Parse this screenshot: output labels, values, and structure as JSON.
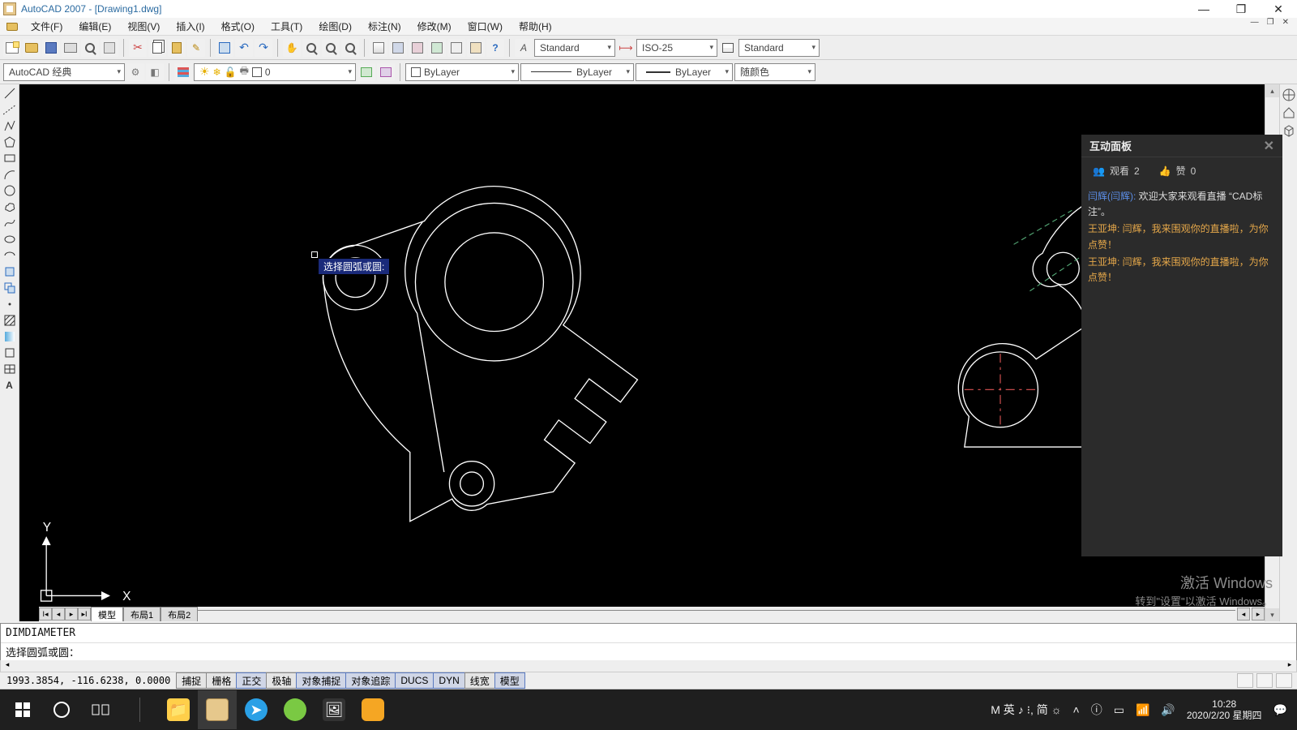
{
  "title": "AutoCAD 2007 - [Drawing1.dwg]",
  "menu": [
    "文件(F)",
    "编辑(E)",
    "视图(V)",
    "插入(I)",
    "格式(O)",
    "工具(T)",
    "绘图(D)",
    "标注(N)",
    "修改(M)",
    "窗口(W)",
    "帮助(H)"
  ],
  "styles": {
    "text_style": "Standard",
    "dim_style": "ISO-25",
    "table_style": "Standard"
  },
  "workspace_selector": "AutoCAD 经典",
  "layer_zero": "0",
  "layer_props": {
    "linetype": "ByLayer",
    "lineweight": "ByLayer",
    "color": "ByLayer",
    "plotcolor": "随颜色"
  },
  "tooltip": "选择圆弧或圆:",
  "chat": {
    "title": "互动面板",
    "views_label": "观看",
    "views": "2",
    "likes_label": "赞",
    "likes": "0",
    "messages": [
      {
        "author": "闫辉(闫辉):",
        "body": " 欢迎大家来观看直播 “CAD标注”。",
        "cls": "blue"
      },
      {
        "author": "王亚坤: ",
        "body": "闫辉，我来围观你的直播啦，为你点赞！",
        "cls": "gold"
      },
      {
        "author": "王亚坤: ",
        "body": "闫辉，我来围观你的直播啦，为你点赞！",
        "cls": "gold"
      }
    ]
  },
  "tabs": {
    "model": "模型",
    "layout1": "布局1",
    "layout2": "布局2"
  },
  "command": {
    "line1": "DIMDIAMETER",
    "line2": "选择圆弧或圆："
  },
  "status": {
    "coords": "1993.3854, -116.6238, 0.0000",
    "buttons": [
      "捕捉",
      "栅格",
      "正交",
      "极轴",
      "对象捕捉",
      "对象追踪",
      "DUCS",
      "DYN",
      "线宽",
      "模型"
    ]
  },
  "ucs": {
    "x": "X",
    "y": "Y"
  },
  "watermark": {
    "l1": "激活 Windows",
    "l2": "转到\"设置\"以激活 Windows。"
  },
  "taskbar": {
    "ime": "M 英 ♪ ⁝,  简 ☼",
    "time": "10:28",
    "date": "2020/2/20 星期四"
  }
}
